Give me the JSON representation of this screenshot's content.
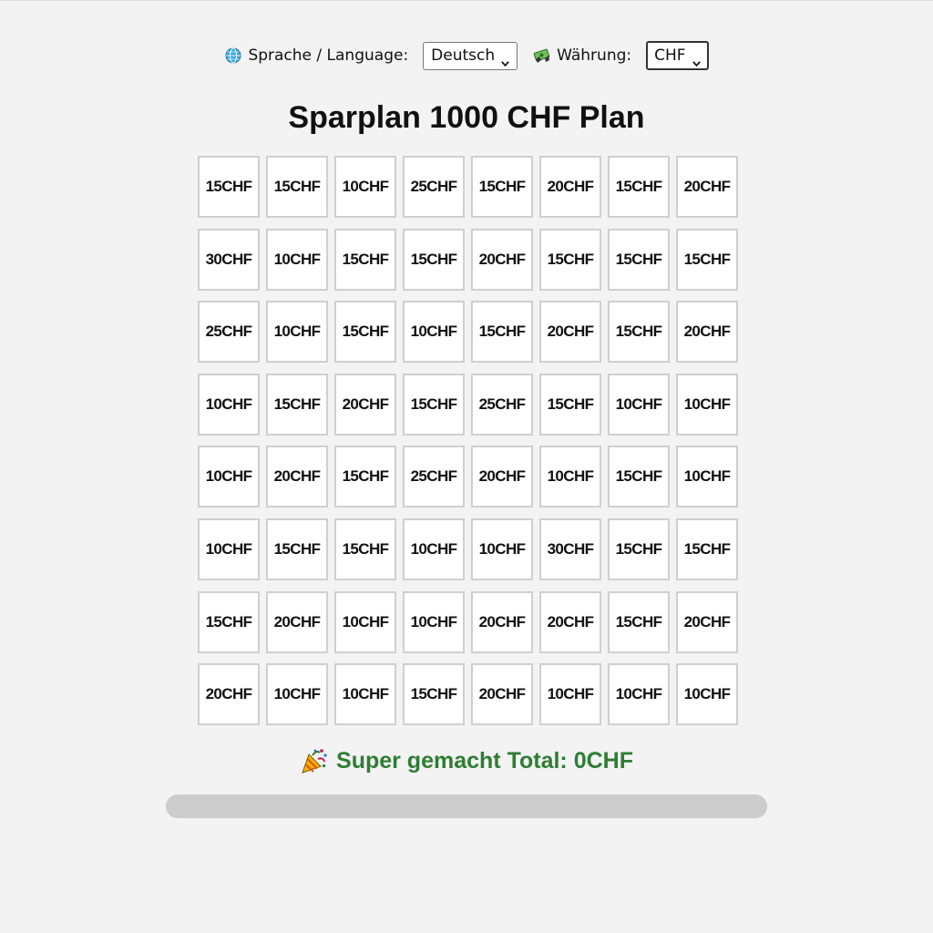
{
  "controls": {
    "language_icon": "globe-icon",
    "language_label": "Sprache / Language:",
    "language_selected": "Deutsch",
    "currency_icon": "money-icon",
    "currency_label": "Währung:",
    "currency_selected": "CHF"
  },
  "title": "Sparplan 1000 CHF Plan",
  "grid": {
    "cells": [
      "15CHF",
      "15CHF",
      "10CHF",
      "25CHF",
      "15CHF",
      "20CHF",
      "15CHF",
      "20CHF",
      "30CHF",
      "10CHF",
      "15CHF",
      "15CHF",
      "20CHF",
      "15CHF",
      "15CHF",
      "15CHF",
      "25CHF",
      "10CHF",
      "15CHF",
      "10CHF",
      "15CHF",
      "20CHF",
      "15CHF",
      "20CHF",
      "10CHF",
      "15CHF",
      "20CHF",
      "15CHF",
      "25CHF",
      "15CHF",
      "10CHF",
      "10CHF",
      "10CHF",
      "20CHF",
      "15CHF",
      "25CHF",
      "20CHF",
      "10CHF",
      "15CHF",
      "10CHF",
      "10CHF",
      "15CHF",
      "15CHF",
      "10CHF",
      "10CHF",
      "30CHF",
      "15CHF",
      "15CHF",
      "15CHF",
      "20CHF",
      "10CHF",
      "10CHF",
      "20CHF",
      "20CHF",
      "15CHF",
      "20CHF",
      "20CHF",
      "10CHF",
      "10CHF",
      "15CHF",
      "20CHF",
      "10CHF",
      "10CHF",
      "10CHF"
    ]
  },
  "status": {
    "icon": "party-popper-icon",
    "text": "Super gemacht Total: 0CHF",
    "color": "#2e7d32"
  },
  "progress": {
    "value_percent": 0,
    "track_color": "#cccccc"
  }
}
